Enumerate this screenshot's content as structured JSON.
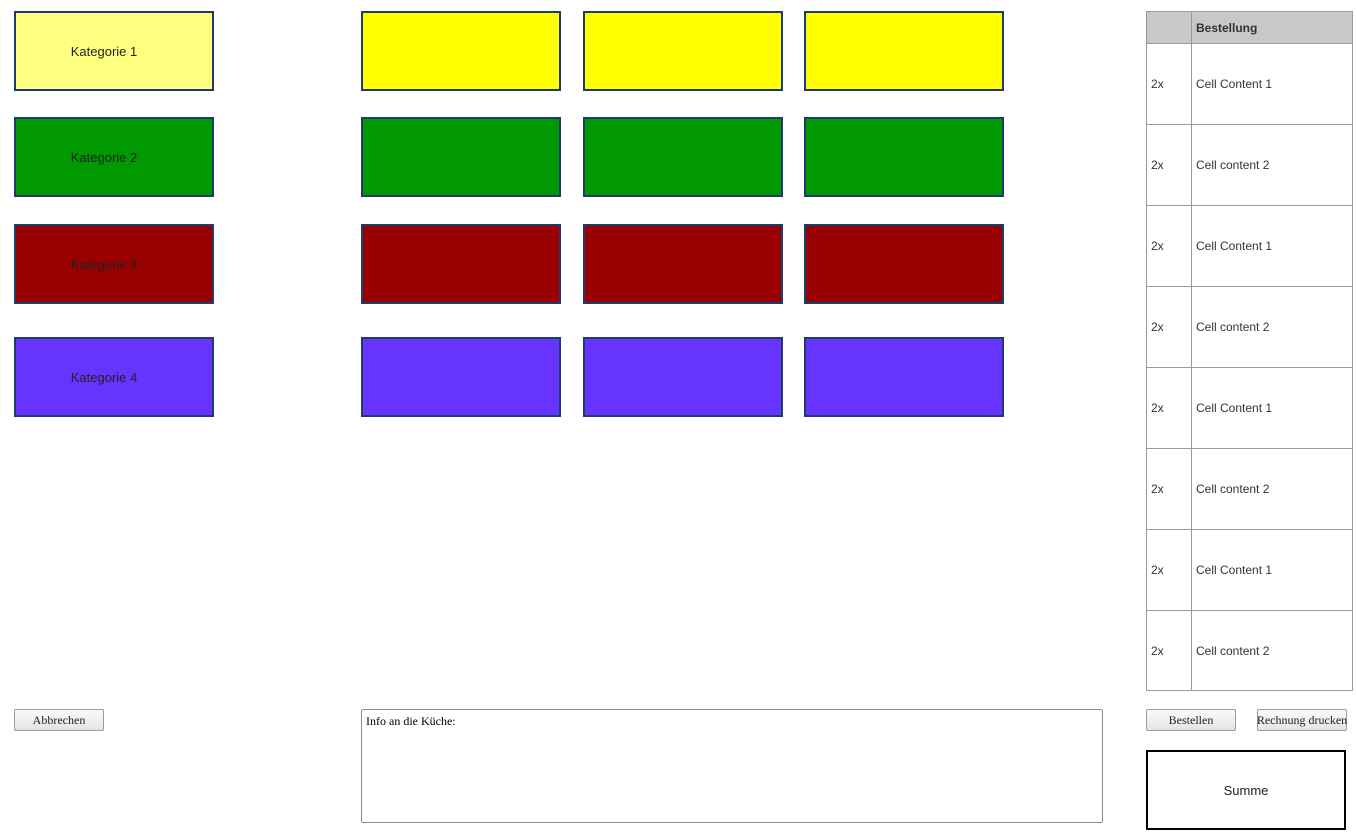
{
  "categories": [
    {
      "label": "Kategorie 1",
      "color": "#ffff80"
    },
    {
      "label": "Kategorie 2",
      "color": "#009900"
    },
    {
      "label": "Kategorie 3",
      "color": "#990000"
    },
    {
      "label": "Kategorie 4",
      "color": "#6633ff"
    }
  ],
  "product_colors": [
    "#ffff00",
    "#009900",
    "#990000",
    "#6633ff"
  ],
  "order_table": {
    "headers": [
      "",
      "Bestellung"
    ],
    "rows": [
      {
        "qty": "2x",
        "item": "Cell Content 1"
      },
      {
        "qty": "2x",
        "item": "Cell content 2"
      },
      {
        "qty": "2x",
        "item": "Cell Content 1"
      },
      {
        "qty": "2x",
        "item": "Cell content 2"
      },
      {
        "qty": "2x",
        "item": "Cell Content 1"
      },
      {
        "qty": "2x",
        "item": "Cell content 2"
      },
      {
        "qty": "2x",
        "item": "Cell Content 1"
      },
      {
        "qty": "2x",
        "item": "Cell content 2"
      }
    ]
  },
  "buttons": {
    "cancel": "Abbrechen",
    "order": "Bestellen",
    "print_bill": "Rechnung drucken"
  },
  "kitchen_info": {
    "value": "Info an die Küche:"
  },
  "sum_label": "Summe"
}
